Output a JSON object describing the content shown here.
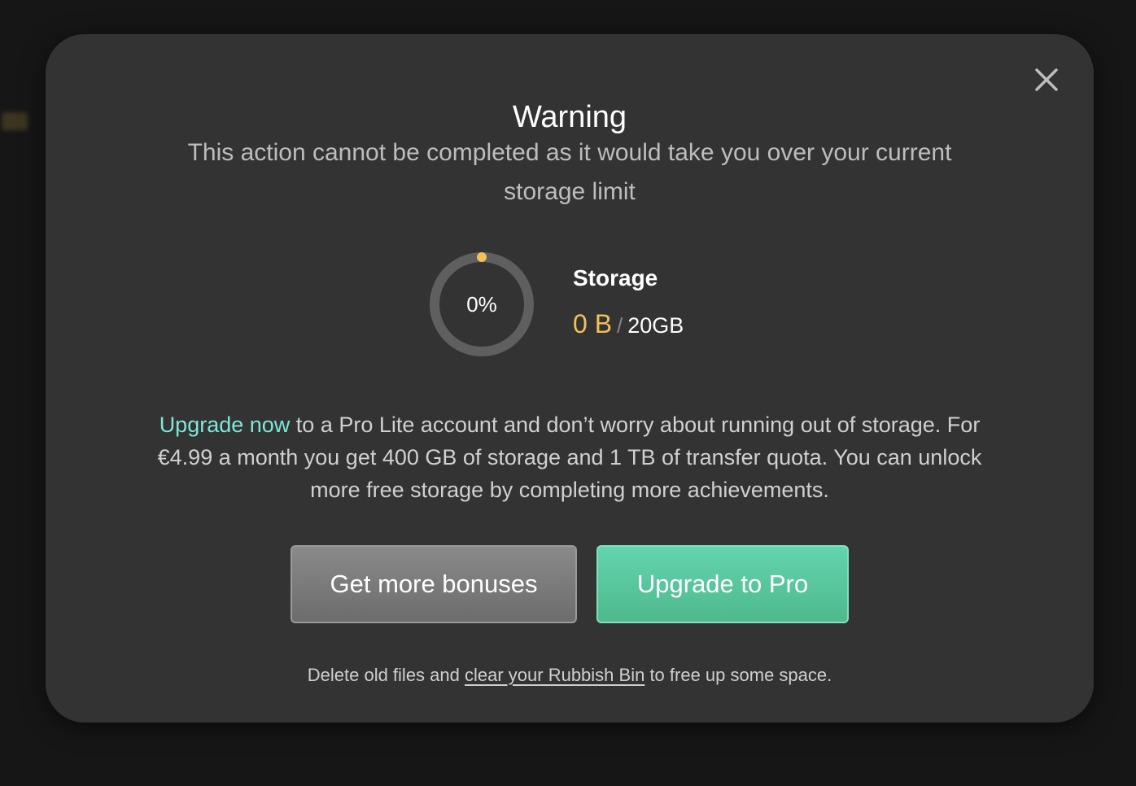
{
  "dialog": {
    "title": "Warning",
    "description": "This action cannot be completed as it would take you over your current storage limit",
    "close_icon": "close-icon"
  },
  "storage": {
    "percent_label": "0%",
    "percent_value": 0,
    "title": "Storage",
    "used": "0 B",
    "separator": "/",
    "total": "20GB"
  },
  "upsell": {
    "link_text": "Upgrade now",
    "body": " to a Pro Lite account and don’t worry about running out of storage. For €4.99 a month you get 400 GB of storage and 1 TB of transfer quota. You can unlock more free storage by completing more achievements."
  },
  "buttons": {
    "bonus_label": "Get more bonuses",
    "pro_label": "Upgrade to Pro"
  },
  "footer": {
    "before": "Delete old files and ",
    "link_text": "clear your Rubbish Bin",
    "after": " to free up some space."
  },
  "colors": {
    "accent_used": "#f0c05a",
    "link": "#7ee8d8",
    "pro_button": "#55c49a",
    "dialog_bg": "#333333"
  }
}
